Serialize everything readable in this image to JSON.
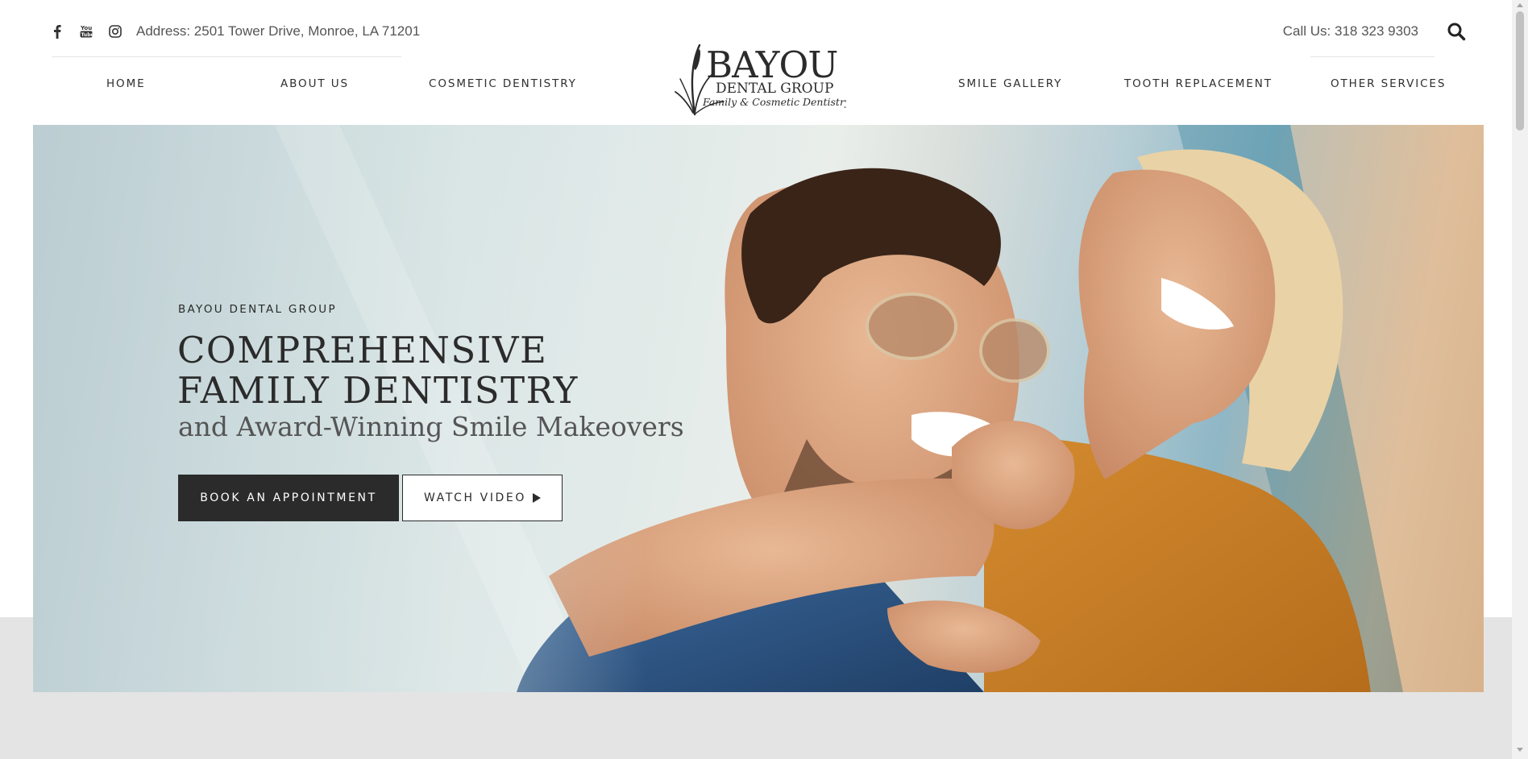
{
  "header": {
    "social_icons": [
      "facebook-icon",
      "youtube-icon",
      "instagram-icon"
    ],
    "address": "Address: 2501 Tower Drive, Monroe, LA 71201",
    "phone": "Call Us: 318 323 9303",
    "search_icon": "search-icon"
  },
  "nav": {
    "left": [
      {
        "label": "HOME"
      },
      {
        "label": "ABOUT US"
      },
      {
        "label": "COSMETIC DENTISTRY"
      }
    ],
    "right": [
      {
        "label": "SMILE GALLERY"
      },
      {
        "label": "TOOTH REPLACEMENT"
      },
      {
        "label": "OTHER SERVICES"
      }
    ]
  },
  "logo": {
    "line1": "BAYOU",
    "line2": "DENTAL GROUP",
    "line3": "Family & Cosmetic Dentistry"
  },
  "hero": {
    "eyebrow": "BAYOU DENTAL GROUP",
    "headline": "COMPREHENSIVE FAMILY DENTISTRY",
    "subhead": "and Award-Winning Smile Makeovers",
    "primary_button": "BOOK AN APPOINTMENT",
    "secondary_button": "WATCH VIDEO",
    "secondary_icon": "play-icon"
  },
  "colors": {
    "dark": "#2b2b2b",
    "band": "#e4e4e4",
    "text_muted": "#555555"
  }
}
